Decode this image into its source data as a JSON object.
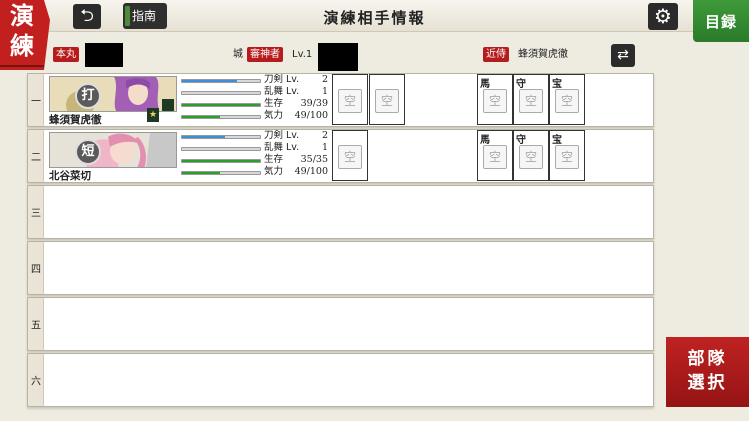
{
  "header": {
    "mode_label": "演練",
    "title": "演練相手情報",
    "guide_label": "指南",
    "list_label": "目録",
    "back_icon": "back-arrow-icon",
    "settings_icon": "gear-icon"
  },
  "opponent": {
    "honmaru_label": "本丸",
    "castle_label": "城",
    "saniwa_label": "審神者",
    "level": "Lv.1",
    "kinji_label": "近侍",
    "kinji_name": "蜂須賀虎徹"
  },
  "units": [
    {
      "num": "一",
      "name": "蜂須賀虎徹",
      "type": "打",
      "rank_badge": "★",
      "sword_lv": "2",
      "ranbu_lv": "1",
      "hp": "39/39",
      "morale": "49/100",
      "sword_fill": 0.7,
      "ranbu_fill": 0.0,
      "hp_fill": 1.0,
      "morale_fill": 0.49,
      "equip_slots": [
        "空",
        "空"
      ],
      "horse": "空",
      "guard": "空",
      "treasure": "空"
    },
    {
      "num": "二",
      "name": "北谷菜切",
      "type": "短",
      "sword_lv": "2",
      "ranbu_lv": "1",
      "hp": "35/35",
      "morale": "49/100",
      "sword_fill": 0.55,
      "ranbu_fill": 0.0,
      "hp_fill": 1.0,
      "morale_fill": 0.49,
      "equip_slots": [
        "空"
      ],
      "horse": "空",
      "guard": "空",
      "treasure": "空"
    }
  ],
  "empty_rows": [
    "三",
    "四",
    "五",
    "六"
  ],
  "stat_labels": {
    "sword": "刀剣",
    "ranbu": "乱舞",
    "hp": "生存",
    "morale": "気力",
    "lv": "Lv."
  },
  "slot_labels": {
    "horse": "馬",
    "guard": "守",
    "treasure": "宝"
  },
  "form_button": "部隊\n選択",
  "colors": {
    "accent_red": "#b71c1c",
    "accent_green": "#2e8b2e",
    "bar_blue": "#3a8fd8",
    "bar_green": "#2aa02a"
  }
}
